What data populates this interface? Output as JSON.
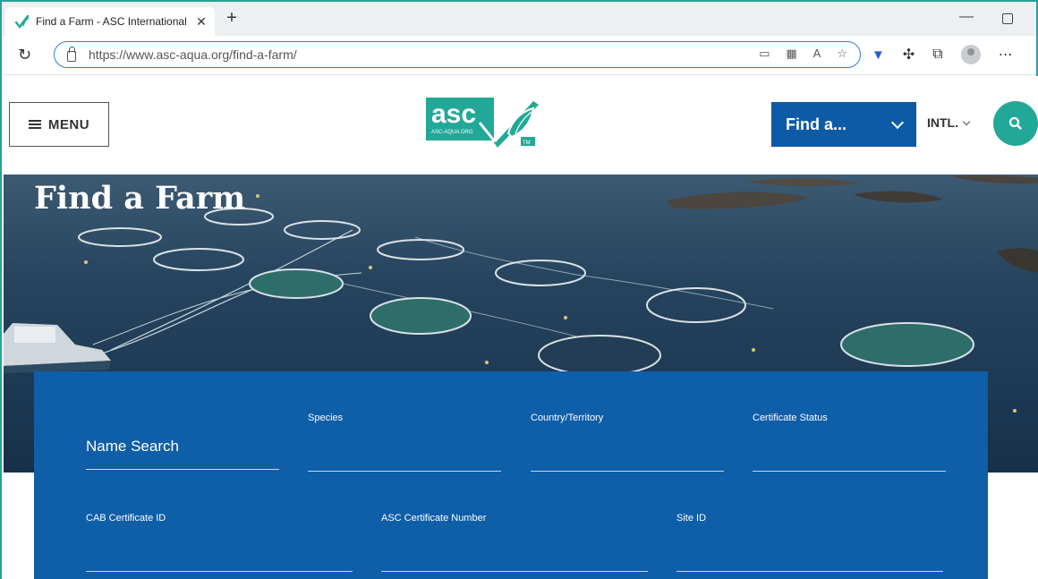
{
  "browser": {
    "tab_title": "Find a Farm - ASC International",
    "tab_close": "✕",
    "new_tab": "+",
    "url": "https://www.asc-aqua.org/find-a-farm/",
    "reload": "↻",
    "minimize": "—"
  },
  "header": {
    "menu_label": "MENU",
    "logo_text": "asc",
    "logo_subtext": "ASC-AQUA.ORG",
    "logo_tm": "TM",
    "find_label": "Find a...",
    "intl_label": "INTL.",
    "brand_color": "#22a897",
    "primary_color": "#0d5ba6"
  },
  "hero": {
    "title": "Find a Farm"
  },
  "search_form": {
    "name_search": "Name Search",
    "species": "Species",
    "country": "Country/Territory",
    "certificate_status": "Certificate Status",
    "cab_certificate_id": "CAB Certificate ID",
    "asc_certificate_number": "ASC Certificate Number",
    "site_id": "Site ID"
  }
}
